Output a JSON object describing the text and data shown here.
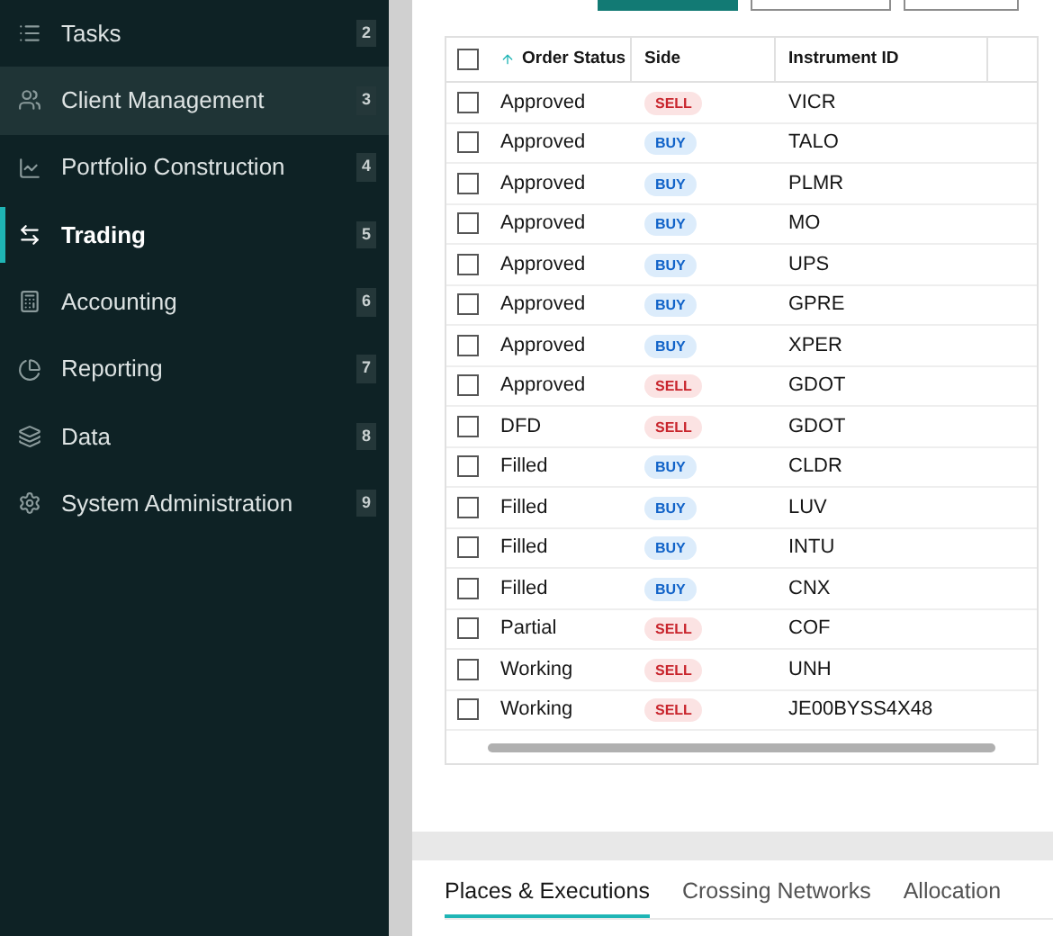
{
  "sidebar": {
    "items": [
      {
        "label": "Tasks",
        "badge": "2",
        "selected": false,
        "hovered": false
      },
      {
        "label": "Client Management",
        "badge": "3",
        "selected": false,
        "hovered": true
      },
      {
        "label": "Portfolio Construction",
        "badge": "4",
        "selected": false,
        "hovered": false
      },
      {
        "label": "Trading",
        "badge": "5",
        "selected": true,
        "hovered": false
      },
      {
        "label": "Accounting",
        "badge": "6",
        "selected": false,
        "hovered": false
      },
      {
        "label": "Reporting",
        "badge": "7",
        "selected": false,
        "hovered": false
      },
      {
        "label": "Data",
        "badge": "8",
        "selected": false,
        "hovered": false
      },
      {
        "label": "System Administration",
        "badge": "9",
        "selected": false,
        "hovered": false
      }
    ]
  },
  "orders": {
    "table": {
      "select_all_checked": false,
      "columns": [
        {
          "label": "Order Status",
          "sorted": true
        },
        {
          "label": "Side",
          "sorted": false
        },
        {
          "label": "Instrument ID",
          "sorted": false
        }
      ],
      "rows": [
        {
          "status": "Approved",
          "side": "SELL",
          "kind": "sell",
          "instrument": "VICR",
          "checked": false
        },
        {
          "status": "Approved",
          "side": "BUY",
          "kind": "buy",
          "instrument": "TALO",
          "checked": false
        },
        {
          "status": "Approved",
          "side": "BUY",
          "kind": "buy",
          "instrument": "PLMR",
          "checked": false
        },
        {
          "status": "Approved",
          "side": "BUY",
          "kind": "buy",
          "instrument": "MO",
          "checked": false
        },
        {
          "status": "Approved",
          "side": "BUY",
          "kind": "buy",
          "instrument": "UPS",
          "checked": false
        },
        {
          "status": "Approved",
          "side": "BUY",
          "kind": "buy",
          "instrument": "GPRE",
          "checked": false
        },
        {
          "status": "Approved",
          "side": "BUY",
          "kind": "buy",
          "instrument": "XPER",
          "checked": false
        },
        {
          "status": "Approved",
          "side": "SELL",
          "kind": "sell",
          "instrument": "GDOT",
          "checked": false
        },
        {
          "status": "DFD",
          "side": "SELL",
          "kind": "sell",
          "instrument": "GDOT",
          "checked": false
        },
        {
          "status": "Filled",
          "side": "BUY",
          "kind": "buy",
          "instrument": "CLDR",
          "checked": false
        },
        {
          "status": "Filled",
          "side": "BUY",
          "kind": "buy",
          "instrument": "LUV",
          "checked": false
        },
        {
          "status": "Filled",
          "side": "BUY",
          "kind": "buy",
          "instrument": "INTU",
          "checked": false
        },
        {
          "status": "Filled",
          "side": "BUY",
          "kind": "buy",
          "instrument": "CNX",
          "checked": false
        },
        {
          "status": "Partial",
          "side": "SELL",
          "kind": "sell",
          "instrument": "COF",
          "checked": false
        },
        {
          "status": "Working",
          "side": "SELL",
          "kind": "sell",
          "instrument": "UNH",
          "checked": false
        },
        {
          "status": "Working",
          "side": "SELL",
          "kind": "sell",
          "instrument": "JE00BYSS4X48",
          "checked": false
        }
      ]
    }
  },
  "bottom_tabs": [
    {
      "label": "Places & Executions",
      "selected": true
    },
    {
      "label": "Crossing Networks",
      "selected": false
    },
    {
      "label": "Allocation",
      "selected": false
    }
  ]
}
